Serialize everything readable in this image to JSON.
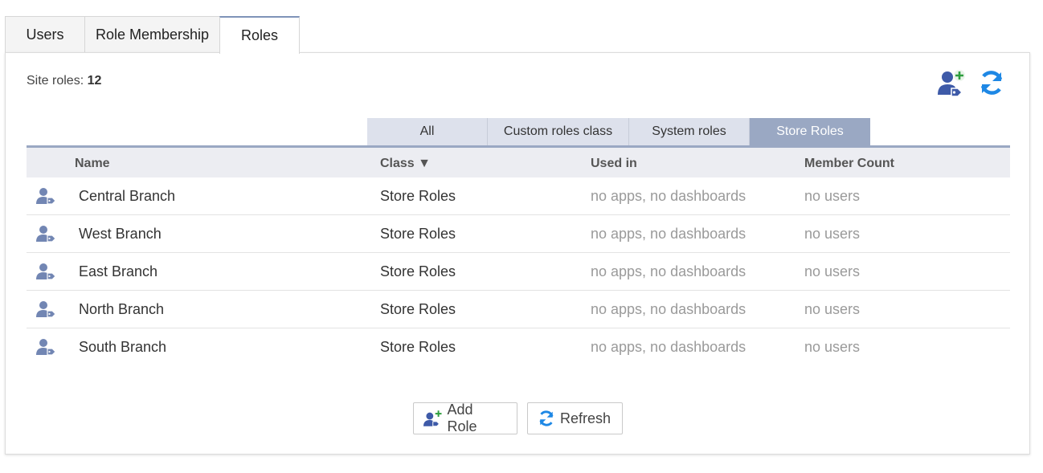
{
  "tabs": [
    {
      "label": "Users"
    },
    {
      "label": "Role Membership"
    },
    {
      "label": "Roles"
    }
  ],
  "site_roles": {
    "label": "Site roles:",
    "count": "12"
  },
  "filters": [
    {
      "label": "All"
    },
    {
      "label": "Custom roles class"
    },
    {
      "label": "System roles"
    },
    {
      "label": "Store Roles"
    }
  ],
  "table": {
    "headers": {
      "name": "Name",
      "class": "Class ▼",
      "used_in": "Used in",
      "member_count": "Member Count"
    },
    "rows": [
      {
        "name": "Central Branch",
        "class": "Store Roles",
        "used_in": "no apps, no dashboards",
        "member_count": "no users"
      },
      {
        "name": "West Branch",
        "class": "Store Roles",
        "used_in": "no apps, no dashboards",
        "member_count": "no users"
      },
      {
        "name": "East Branch",
        "class": "Store Roles",
        "used_in": "no apps, no dashboards",
        "member_count": "no users"
      },
      {
        "name": "North Branch",
        "class": "Store Roles",
        "used_in": "no apps, no dashboards",
        "member_count": "no users"
      },
      {
        "name": "South Branch",
        "class": "Store Roles",
        "used_in": "no apps, no dashboards",
        "member_count": "no users"
      }
    ]
  },
  "buttons": {
    "add_role": "Add Role",
    "refresh": "Refresh"
  },
  "icons": {
    "add_role": "user-tag-plus-icon",
    "refresh": "refresh-icon",
    "role": "user-tag-icon"
  },
  "colors": {
    "accent": "#9aa8c3",
    "icon_blue": "#3e5aa8",
    "refresh_blue": "#1e88e5",
    "plus_green": "#2e9e3e",
    "row_icon": "#7286b3"
  }
}
